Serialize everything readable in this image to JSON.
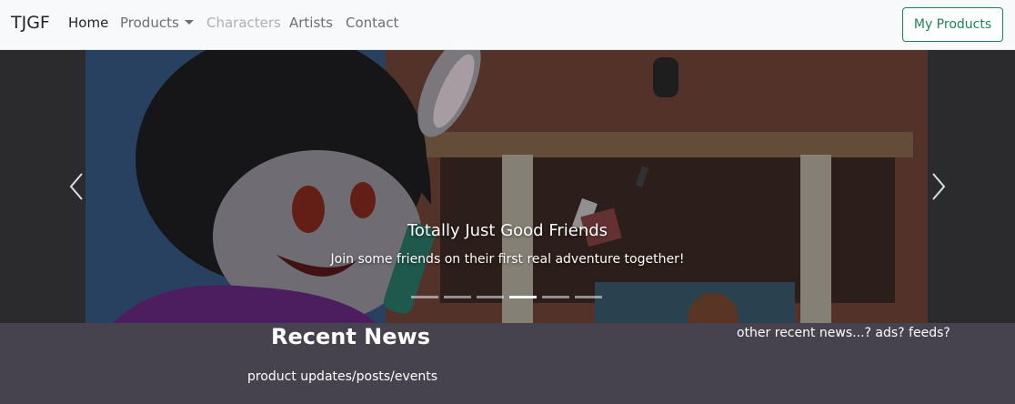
{
  "navbar": {
    "brand": "TJGF",
    "links": [
      {
        "label": "Home"
      },
      {
        "label": "Products"
      },
      {
        "label": "Characters"
      },
      {
        "label": "Artists"
      },
      {
        "label": "Contact"
      }
    ],
    "my_products_label": "My Products"
  },
  "carousel": {
    "caption_title": "Totally Just Good Friends",
    "caption_text": "Join some friends on their first real adventure together!",
    "slide_count": 6,
    "active_slide": 4,
    "prev_icon": "chevron-left-icon",
    "next_icon": "chevron-right-icon"
  },
  "news": {
    "title": "Recent News",
    "subtitle": "product updates/posts/events",
    "side_note": "other recent news...? ads? feeds?"
  },
  "colors": {
    "navbar_bg": "#f8f9fa",
    "accent_green": "#198754",
    "page_bg": "#46434f"
  }
}
